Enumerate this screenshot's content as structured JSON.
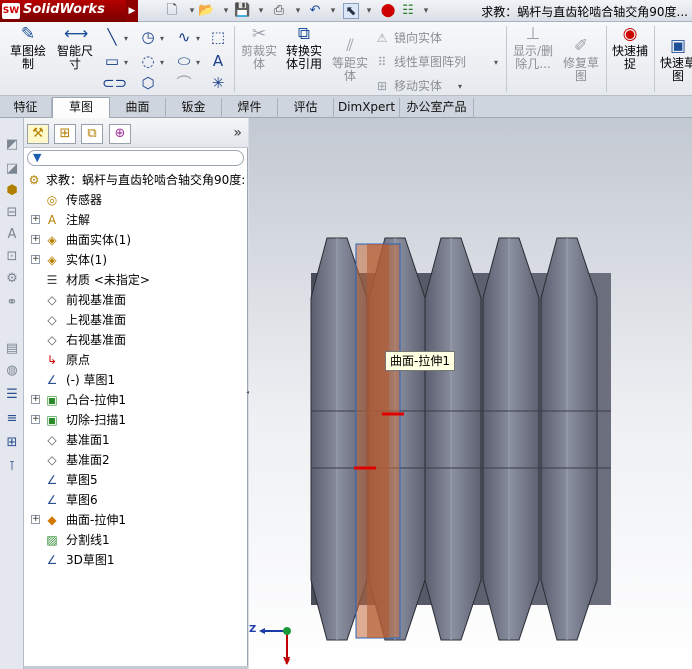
{
  "app": {
    "logo_badge": "SW",
    "name": "SolidWorks",
    "window_title": "求教：蜗杆与直齿轮啮合轴交角90度..."
  },
  "command_manager": {
    "sketch": "草图绘\n制",
    "smart_dim": "智能尺\n寸",
    "trim": "剪裁实\n体",
    "convert": "转换实\n体引用",
    "offset": "等距实\n体",
    "mirror": "镜向实体",
    "linear_pattern": "线性草图阵列",
    "move": "移动实体",
    "show_delete": "显示/删\n除几...",
    "repair": "修复草\n图",
    "quick_snap": "快速捕\n捉",
    "quick_view": "快速草\n图"
  },
  "tabs": [
    "特征",
    "草图",
    "曲面",
    "钣金",
    "焊件",
    "评估",
    "DimXpert",
    "办公室产品"
  ],
  "active_tab": 1,
  "feature_tree": {
    "root": "求教：蜗杆与直齿轮啮合轴交角90度:",
    "items": [
      {
        "label": "传感器",
        "expand": false
      },
      {
        "label": "注解",
        "expand": true
      },
      {
        "label": "曲面实体(1)",
        "expand": true
      },
      {
        "label": "实体(1)",
        "expand": true
      },
      {
        "label": "材质 <未指定>",
        "expand": false
      },
      {
        "label": "前视基准面",
        "expand": false
      },
      {
        "label": "上视基准面",
        "expand": false
      },
      {
        "label": "右视基准面",
        "expand": false
      },
      {
        "label": "原点",
        "expand": false
      },
      {
        "label": "(-) 草图1",
        "expand": false
      },
      {
        "label": "凸台-拉伸1",
        "expand": true
      },
      {
        "label": "切除-扫描1",
        "expand": true
      },
      {
        "label": "基准面1",
        "expand": false
      },
      {
        "label": "基准面2",
        "expand": false
      },
      {
        "label": "草图5",
        "expand": false
      },
      {
        "label": "草图6",
        "expand": false
      },
      {
        "label": "曲面-拉伸1",
        "expand": true
      },
      {
        "label": "分割线1",
        "expand": false
      },
      {
        "label": "3D草图1",
        "expand": false
      }
    ]
  },
  "viewport": {
    "tooltip": "曲面-拉伸1",
    "triad_z": "Z",
    "triad_y": "Y"
  },
  "colors": {
    "worm_body": "#6e7282",
    "surface_highlight": "#c46a3c",
    "selection": "#2a62b8"
  }
}
